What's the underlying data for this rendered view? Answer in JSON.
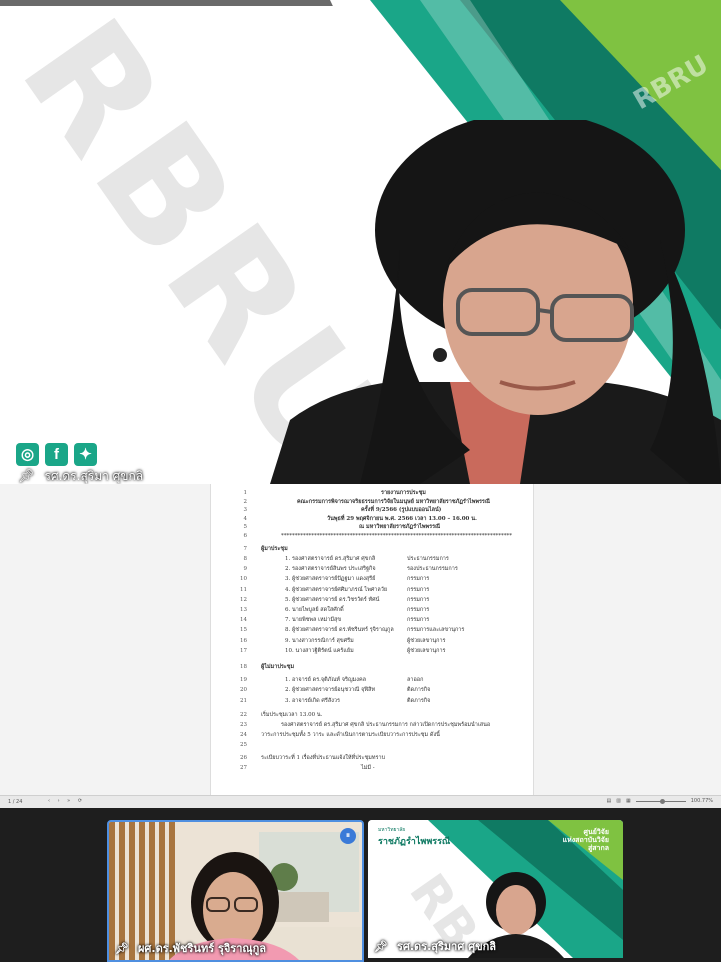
{
  "main_speaker": {
    "name": "รศ.ดร.สุริมา ศุขกลิ",
    "watermark": "RBRU",
    "social_icons": [
      "instagram-icon",
      "facebook-icon",
      "twitter-icon"
    ]
  },
  "document": {
    "lines": [
      {
        "n": "1",
        "text": "รายงานการประชุม",
        "indent": 120,
        "bold": true
      },
      {
        "n": "2",
        "text": "คณะกรรมการพิจารณาจริยธรรมการวิจัยในมนุษย์ มหาวิทยาลัยราชภัฏรำไพพรรณี",
        "indent": 36,
        "bold": true
      },
      {
        "n": "3",
        "text": "ครั้งที่ 9/2566 (รูปแบบออนไลน์)",
        "indent": 100,
        "bold": true
      },
      {
        "n": "4",
        "text": "วันพุธที่ 29 พฤศจิกายน พ.ศ. 2566  เวลา 13.00 – 16.00 น.",
        "indent": 66,
        "bold": true
      },
      {
        "n": "5",
        "text": "ณ มหาวิทยาลัยราชภัฏรำไพพรรณี",
        "indent": 98,
        "bold": true
      },
      {
        "n": "6",
        "text": "************************************************************************************",
        "indent": 20,
        "bold": false
      },
      {
        "n": "7",
        "text": "ผู้มาประชุม",
        "indent": 0,
        "bold": true
      },
      {
        "n": "8",
        "text": "1.  รองศาสตราจารย์ ดร.สุริมาศ  ศุขกลิ",
        "indent": 24,
        "bold": false,
        "role": "ประธานกรรมการ"
      },
      {
        "n": "9",
        "text": "2.  รองศาสตราจารย์สินพร  ประเสริฐกิจ",
        "indent": 24,
        "bold": false,
        "role": "รองประธานกรรมการ"
      },
      {
        "n": "10",
        "text": "3.  ผู้ช่วยศาสตราจารย์ปัฏฐมา  แดงสุรีย์",
        "indent": 24,
        "bold": false,
        "role": "กรรมการ"
      },
      {
        "n": "11",
        "text": "4.  ผู้ช่วยศาสตราจารย์ศศิมาภรณ์ ไพศาลวัย",
        "indent": 24,
        "bold": false,
        "role": "กรรมการ"
      },
      {
        "n": "12",
        "text": "5.  ผู้ช่วยศาสตราจารย์ ดร.วิชรวัตร์  ทัศน์",
        "indent": 24,
        "bold": false,
        "role": "กรรมการ"
      },
      {
        "n": "13",
        "text": "6.  นายไพบูลย์ สดใสศักดิ์",
        "indent": 24,
        "bold": false,
        "role": "กรรมการ"
      },
      {
        "n": "14",
        "text": "7.  นายพิชพล เหม่ามีสุข",
        "indent": 24,
        "bold": false,
        "role": "กรรมการ"
      },
      {
        "n": "15",
        "text": "8.  ผู้ช่วยศาสตราจารย์ ดร.พัชรินทร์  รุจิราณุกูล",
        "indent": 24,
        "bold": false,
        "role": "กรรมการและเลขานุการ"
      },
      {
        "n": "16",
        "text": "9.  นางสาวกรรณิการ์  สุขศรีม",
        "indent": 24,
        "bold": false,
        "role": "ผู้ช่วยเลขานุการ"
      },
      {
        "n": "17",
        "text": "10. นางสาวฐิติรัตน์  แคร้แย้ม",
        "indent": 24,
        "bold": false,
        "role": "ผู้ช่วยเลขานุการ"
      },
      {
        "n": "18",
        "text": "ผู้ไม่มาประชุม",
        "indent": 0,
        "bold": true
      },
      {
        "n": "19",
        "text": "1.  อาจารย์ ดร.จุติภัณท์  จริญมงคล",
        "indent": 24,
        "bold": false,
        "role": "ลาออก"
      },
      {
        "n": "20",
        "text": "2.  ผู้ช่วยศาสตราจารย์อนุชวาณี  จุฬีสิท",
        "indent": 24,
        "bold": false,
        "role": "ติดภารกิจ"
      },
      {
        "n": "21",
        "text": "3.  อาจารย์เกิด  ศรีสังวร",
        "indent": 24,
        "bold": false,
        "role": "ติดภารกิจ"
      },
      {
        "n": "22",
        "text": "เริ่มประชุมเวลา 13.00 น.",
        "indent": 0,
        "bold": false
      },
      {
        "n": "23",
        "text": "รองศาสตราจารย์ ดร.สุริมาศ ศุขกลิ ประธานกรรมการ กล่าวเปิดการประชุมพร้อมนำเสนอ",
        "indent": 20,
        "bold": false
      },
      {
        "n": "24",
        "text": "วาระการประชุมทั้ง 5 วาระ และดำเนินการตามระเบียบวาระการประชุม ดังนี้",
        "indent": 0,
        "bold": false
      },
      {
        "n": "25",
        "text": "",
        "indent": 0,
        "bold": false
      },
      {
        "n": "26",
        "text": "ระเบียบวาระที่ 1  เรื่องที่ประธานแจ้งให้ที่ประชุมทราบ",
        "indent": 0,
        "bold": false
      },
      {
        "n": "27",
        "text": "ไม่มี -",
        "indent": 100,
        "bold": false
      }
    ]
  },
  "statusbar": {
    "page": "1 / 24",
    "nav_arrows": "‹ › » ⟳",
    "zoom": "100.77%"
  },
  "participants": [
    {
      "name": "ผศ.ดร.พัชรินทร์ รุจิราณุกูล",
      "speaking": true
    },
    {
      "name": "รศ.ดร.สุริมาศ ศุขกลิ",
      "speaking": false
    }
  ],
  "tile2_header": {
    "org": "ราชภัฏรำไพพรรณี",
    "pre": "มหาวิทยาลัย",
    "right_line1": "ศูนย์วิจัย",
    "right_line2": "แห่งสถาบันวิจัย",
    "right_line3": "สู่สากล"
  },
  "colors": {
    "accent_green": "#1aa688",
    "light_green": "#7fc241",
    "dark_green": "#0f7a63",
    "active_border": "#4f8fe0"
  }
}
